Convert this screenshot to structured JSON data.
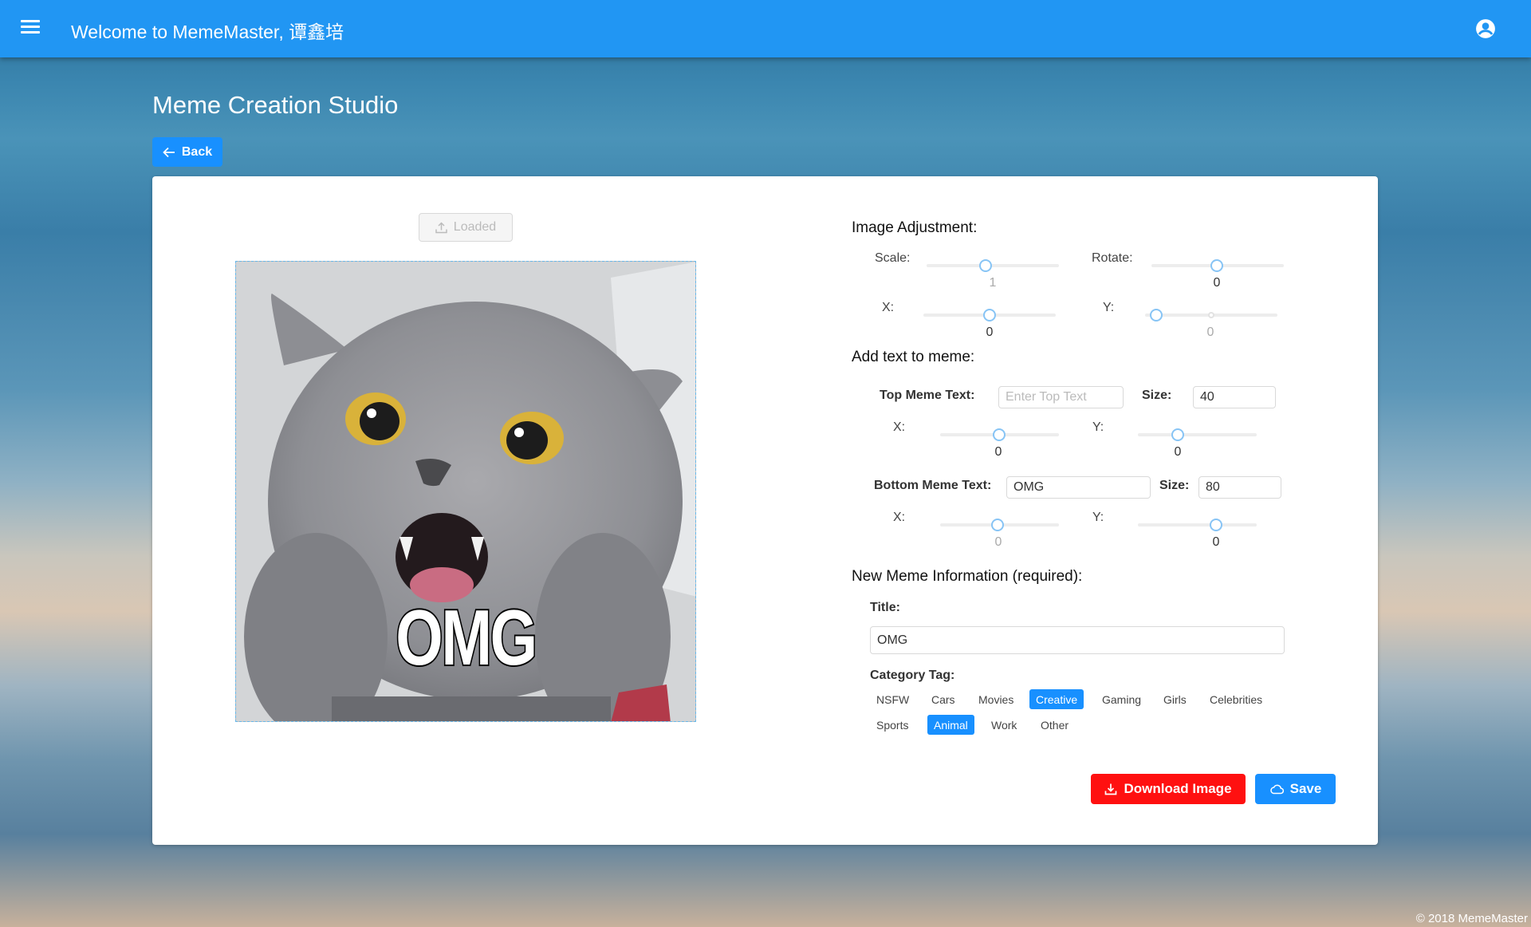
{
  "header": {
    "title": "Welcome to MemeMaster, 谭鑫培",
    "menu_icon": "hamburger-menu-icon",
    "account_icon": "user-circle-icon"
  },
  "page": {
    "heading": "Meme Creation Studio",
    "back_label": "Back"
  },
  "image_panel": {
    "loaded_label": "Loaded",
    "meme_top_text": "",
    "meme_bottom_text": "OMG"
  },
  "image_adjustment": {
    "heading": "Image Adjustment:",
    "scale": {
      "label": "Scale:",
      "value": "1"
    },
    "rotate": {
      "label": "Rotate:",
      "value": "0"
    },
    "x": {
      "label": "X:",
      "value": "0"
    },
    "y": {
      "label": "Y:",
      "value": "0"
    }
  },
  "meme_text": {
    "heading": "Add text to meme:",
    "top": {
      "label": "Top Meme Text:",
      "placeholder": "Enter Top Text",
      "value": "",
      "size_label": "Size:",
      "size_value": "40",
      "x_label": "X:",
      "x_value": "0",
      "y_label": "Y:",
      "y_value": "0"
    },
    "bottom": {
      "label": "Bottom Meme Text:",
      "value": "OMG",
      "size_label": "Size:",
      "size_value": "80",
      "x_label": "X:",
      "x_value": "0",
      "y_label": "Y:",
      "y_value": "0"
    }
  },
  "meme_info": {
    "heading": "New Meme Information (required):",
    "title_label": "Title:",
    "title_value": "OMG",
    "category_label": "Category Tag:",
    "tags": [
      {
        "label": "NSFW",
        "selected": false
      },
      {
        "label": "Cars",
        "selected": false
      },
      {
        "label": "Movies",
        "selected": false
      },
      {
        "label": "Creative",
        "selected": true
      },
      {
        "label": "Gaming",
        "selected": false
      },
      {
        "label": "Girls",
        "selected": false
      },
      {
        "label": "Celebrities",
        "selected": false
      },
      {
        "label": "Sports",
        "selected": false
      },
      {
        "label": "Animal",
        "selected": true
      },
      {
        "label": "Work",
        "selected": false
      },
      {
        "label": "Other",
        "selected": false
      }
    ]
  },
  "actions": {
    "download_label": "Download Image",
    "save_label": "Save"
  },
  "footer": {
    "copyright": "© 2018 MemeMaster"
  },
  "colors": {
    "primary": "#1890ff",
    "header": "#2196f3",
    "danger": "#ff1010"
  }
}
